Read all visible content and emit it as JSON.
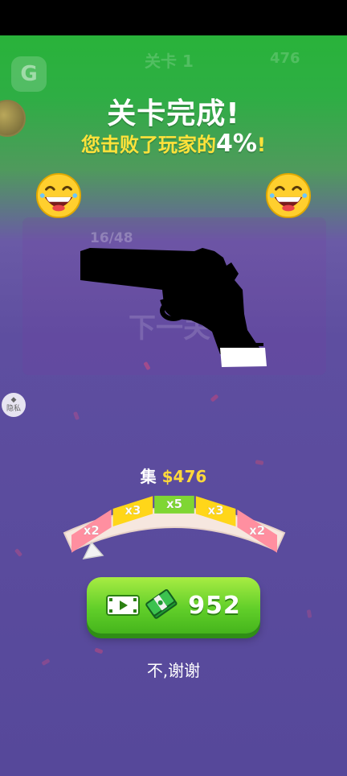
{
  "status_bar": {},
  "background_hud": {
    "level": "关卡 1",
    "coins": "476",
    "ammo": "16/48",
    "next": "下一关"
  },
  "title": "关卡完成!",
  "subtitle": {
    "prefix": "您击败了玩家的",
    "percent": "4%",
    "suffix": "!"
  },
  "privacy": "隐私",
  "collect": {
    "label": "集",
    "amount": "$476"
  },
  "multiplier_wheel": {
    "segments": [
      "x2",
      "x3",
      "x5",
      "x3",
      "x2"
    ],
    "colors": [
      "#ff8fa0",
      "#ffd619",
      "#7fd633",
      "#ffd619",
      "#ff8fa0"
    ]
  },
  "reward_button": {
    "value": "952",
    "icons": [
      "video-icon",
      "cash-stack-icon"
    ]
  },
  "skip": "不,谢谢",
  "colors": {
    "accent_yellow": "#ffe23a",
    "button_green": "#62cf2a"
  }
}
